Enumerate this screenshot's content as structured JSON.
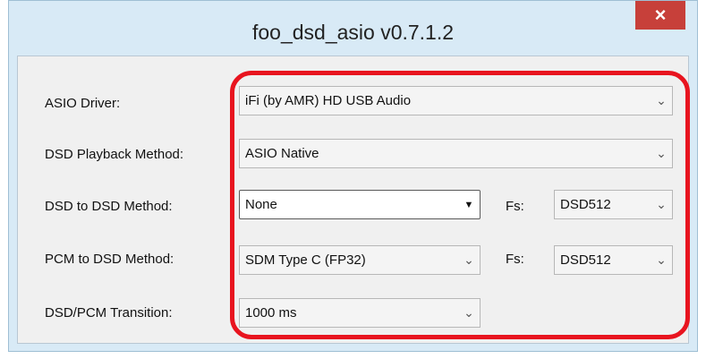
{
  "window": {
    "title": "foo_dsd_asio v0.7.1.2",
    "close_glyph": "×"
  },
  "rows": {
    "asio_driver": {
      "label": "ASIO Driver:",
      "value": "iFi (by AMR) HD USB Audio"
    },
    "dsd_playback": {
      "label": "DSD Playback Method:",
      "value": "ASIO Native"
    },
    "dsd_to_dsd": {
      "label": "DSD to DSD Method:",
      "value": "None",
      "fs_label": "Fs:",
      "fs_value": "DSD512"
    },
    "pcm_to_dsd": {
      "label": "PCM to DSD Method:",
      "value": "SDM Type C (FP32)",
      "fs_label": "Fs:",
      "fs_value": "DSD512"
    },
    "transition": {
      "label": "DSD/PCM Transition:",
      "value": "1000 ms"
    }
  },
  "glyphs": {
    "chevron": "⌄",
    "triangle": "▼"
  },
  "colors": {
    "highlight": "#e8141f",
    "close": "#c7403a",
    "title_bg": "#d8eaf6"
  }
}
